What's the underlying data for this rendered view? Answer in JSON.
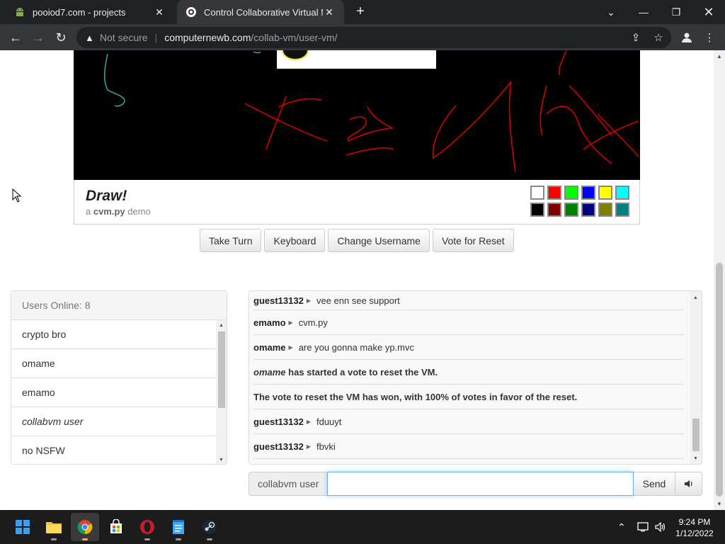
{
  "browser": {
    "tabs": [
      {
        "title": "pooiod7.com - projects",
        "active": false
      },
      {
        "title": "Control Collaborative Virtual Mac",
        "active": true
      }
    ],
    "security_label": "Not secure",
    "url_host": "computernewb.com",
    "url_path": "/collab-vm/user-vm/"
  },
  "vm": {
    "title": "Draw!",
    "subtitle_prefix": "a ",
    "subtitle_app": "cvm.py",
    "subtitle_suffix": " demo",
    "palette": [
      "#ffffff",
      "#ff0000",
      "#00ff00",
      "#0000ff",
      "#ffff00",
      "#00ffff",
      "#000000",
      "#800000",
      "#008000",
      "#000080",
      "#808000",
      "#008080"
    ]
  },
  "controls": {
    "take_turn": "Take Turn",
    "keyboard": "Keyboard",
    "change_username": "Change Username",
    "vote_reset": "Vote for Reset"
  },
  "users": {
    "header": "Users Online: 8",
    "list": [
      {
        "name": "crypto bro",
        "italic": false
      },
      {
        "name": "omame",
        "italic": false
      },
      {
        "name": "emamo",
        "italic": false
      },
      {
        "name": "collabvm user",
        "italic": true
      },
      {
        "name": "no NSFW",
        "italic": false
      }
    ]
  },
  "chat": {
    "messages": [
      {
        "user": "guest13132",
        "text": "vee enn see support"
      },
      {
        "user": "emamo",
        "text": "cvm.py"
      },
      {
        "user": "omame",
        "text": "are you gonna make yp.mvc"
      },
      {
        "system_user": "omame",
        "system_text": " has started a vote to reset the VM."
      },
      {
        "system_text_full": "The vote to reset the VM has won, with 100% of votes in favor of the reset."
      },
      {
        "user": "guest13132",
        "text": "fduuyt"
      },
      {
        "user": "guest13132",
        "text": "fbvki"
      }
    ],
    "username": "collabvm user",
    "input_value": "",
    "send_label": "Send"
  },
  "taskbar": {
    "time": "9:24 PM",
    "date": "1/12/2022"
  }
}
